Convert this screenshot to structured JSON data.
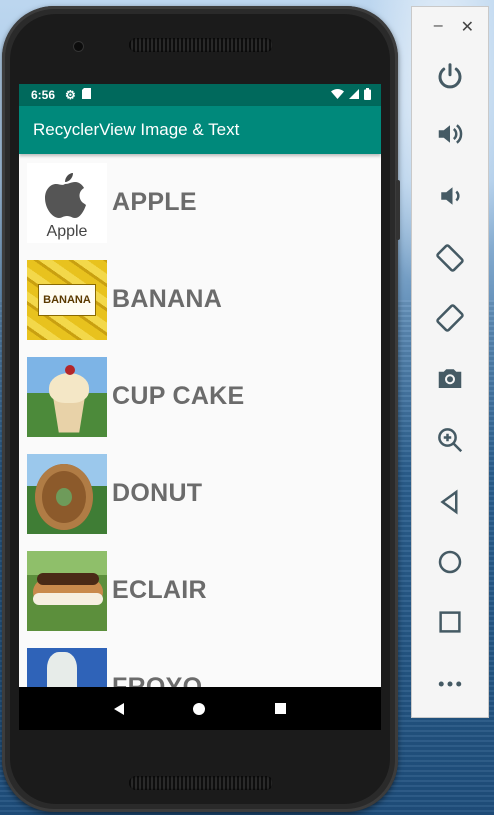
{
  "status_bar": {
    "time": "6:56"
  },
  "app_bar": {
    "title": "RecyclerView Image & Text"
  },
  "list": {
    "items": [
      {
        "label": "APPLE",
        "image_caption": "Apple"
      },
      {
        "label": "BANANA",
        "image_caption": "BANANA"
      },
      {
        "label": "CUP CAKE"
      },
      {
        "label": "DONUT"
      },
      {
        "label": "ECLAIR"
      },
      {
        "label": "FROYO"
      }
    ]
  },
  "emulator_toolbar": {
    "buttons": [
      "power",
      "volume-up",
      "volume-down",
      "rotate-left",
      "rotate-right",
      "screenshot",
      "zoom",
      "back",
      "home",
      "overview",
      "more"
    ]
  },
  "colors": {
    "status_bar": "#00695c",
    "app_bar": "#00897b",
    "list_text": "#6b6b6b"
  }
}
